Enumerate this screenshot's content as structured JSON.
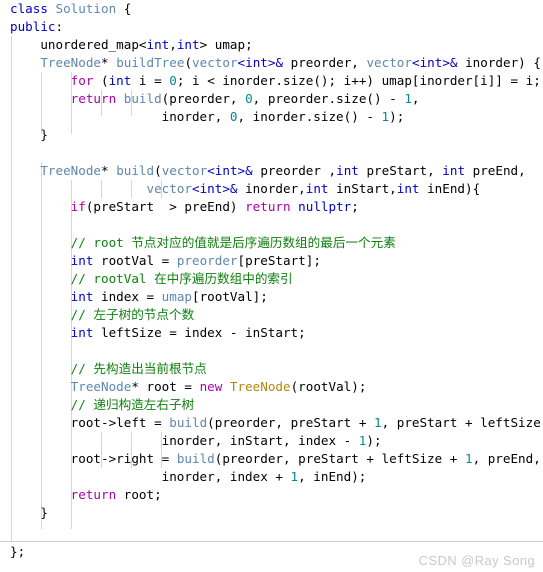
{
  "editor": {
    "language": "cpp",
    "watermark": "CSDN @Ray Song",
    "background_color": "#ffffff",
    "indent_guide_color": "#d6d6d6",
    "colors": {
      "keyword": "#0000c0",
      "control": "#aa00aa",
      "type": "#5f87af",
      "constructor": "#b8860b",
      "number": "#008b8b",
      "comment": "#108010",
      "plain": "#000000"
    }
  },
  "code": {
    "line01": {
      "kw": "class",
      "type": "Solution",
      "brace": "{"
    },
    "line02": {
      "kw": "public",
      "colon": ":"
    },
    "line03": {
      "a": "    unordered_map<",
      "int1": "int",
      "comma": ",",
      "int2": "int",
      "b": "> umap;"
    },
    "line04": {
      "indent": "    ",
      "type1": "TreeNode",
      "star": "* ",
      "fn": "buildTree",
      "p1": "(",
      "type2": "vector",
      "lt1": "<",
      "int1": "int",
      "gt1": ">",
      "amp1": "&",
      "arg1": " preorder, ",
      "type3": "vector",
      "lt2": "<",
      "int2": "int",
      "gt2": ">",
      "amp2": "&",
      "arg2": " inorder) {"
    },
    "line05": {
      "indent": "        ",
      "ctrl": "for",
      "a": " (",
      "kw": "int",
      "b": " i = ",
      "num0": "0",
      "c": "; i < inorder.size(); i++) umap[inorder[i]] = i;"
    },
    "line06": {
      "indent": "        ",
      "ctrl": "return",
      "fn": " build",
      "a": "(preorder, ",
      "num0": "0",
      "b": ", preorder.size() - ",
      "num1": "1",
      "c": ","
    },
    "line07": {
      "text": "                    inorder, ",
      "num0": "0",
      "b": ", inorder.size() - ",
      "num1": "1",
      "c": ");"
    },
    "line08": {
      "text": "    }"
    },
    "line09": {
      "text": ""
    },
    "line10": {
      "indent": "    ",
      "type1": "TreeNode",
      "star": "* ",
      "fn": "build",
      "p1": "(",
      "type2": "vector",
      "lt1": "<",
      "int1": "int",
      "gt1": ">",
      "amp1": "&",
      "arg1": " preorder ,",
      "int2": "int",
      "arg2": " preStart, ",
      "int3": "int",
      "arg3": " preEnd,"
    },
    "line11": {
      "indent": "                  ",
      "type2": "vector",
      "lt1": "<",
      "int1": "int",
      "gt1": ">",
      "amp1": "&",
      "arg1": " inorder,",
      "int2": "int",
      "arg2": " inStart,",
      "int3": "int",
      "arg3": " inEnd){"
    },
    "line12": {
      "indent": "        ",
      "ctrl1": "if",
      "a": "(preStart  > preEnd) ",
      "ctrl2": "return",
      "kw": " nullptr",
      "b": ";"
    },
    "line13": {
      "text": ""
    },
    "line14": {
      "indent": "        ",
      "cmt": "// root 节点对应的值就是后序遍历数组的最后一个元素"
    },
    "line15": {
      "indent": "        ",
      "kw": "int",
      "a": " rootVal = ",
      "id": "preorder",
      "b": "[preStart];"
    },
    "line16": {
      "indent": "        ",
      "cmt": "// rootVal 在中序遍历数组中的索引"
    },
    "line17": {
      "indent": "        ",
      "kw": "int",
      "a": " index = ",
      "id": "umap",
      "b": "[rootVal];"
    },
    "line18": {
      "indent": "        ",
      "cmt": "// 左子树的节点个数"
    },
    "line19": {
      "indent": "        ",
      "kw": "int",
      "a": " leftSize = index - inStart;"
    },
    "line20": {
      "text": ""
    },
    "line21": {
      "indent": "        ",
      "cmt": "// 先构造出当前根节点"
    },
    "line22": {
      "indent": "        ",
      "type": "TreeNode",
      "a": "* root = ",
      "ctrl": "new",
      "ctor": " TreeNode",
      "b": "(rootVal);"
    },
    "line23": {
      "indent": "        ",
      "cmt": "// 递归构造左右子树"
    },
    "line24": {
      "indent": "        ",
      "a": "root->left = ",
      "fn": "build",
      "b": "(preorder, preStart + ",
      "num1": "1",
      "c": ", preStart + leftSize,"
    },
    "line25": {
      "text": "                    inorder, inStart, index - ",
      "num1": "1",
      "b": ");"
    },
    "line26": {
      "indent": "        ",
      "a": "root->right = ",
      "fn": "build",
      "b": "(preorder, preStart + leftSize + ",
      "num1": "1",
      "c": ", preEnd,"
    },
    "line27": {
      "text": "                    inorder, index + ",
      "num1": "1",
      "b": ", inEnd);"
    },
    "line28": {
      "indent": "        ",
      "ctrl": "return",
      "a": " root;"
    },
    "line29": {
      "text": "    }"
    },
    "line30": {
      "text": ""
    },
    "line31": {
      "text": ""
    },
    "footer": {
      "text": "};"
    }
  }
}
